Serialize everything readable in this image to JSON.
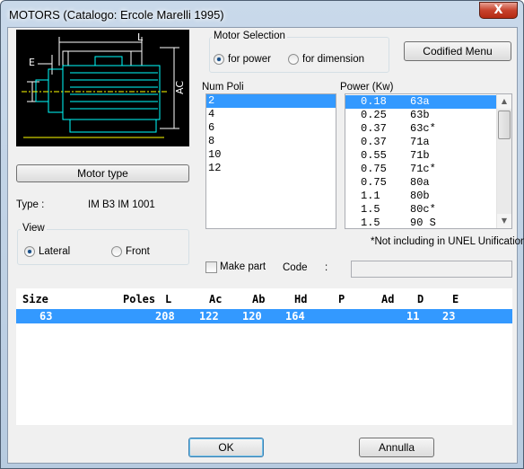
{
  "window": {
    "title": "MOTORS (Catalogo: Ercole Marelli 1995)",
    "close_label": "X"
  },
  "motor_selection": {
    "label": "Motor Selection",
    "options": [
      {
        "label": "for power",
        "selected": true
      },
      {
        "label": "for dimension",
        "selected": false
      }
    ]
  },
  "codified_menu_label": "Codified Menu",
  "drawing": {
    "dim_l": "L",
    "dim_e": "E",
    "dim_ac": "AC"
  },
  "num_poli": {
    "label": "Num Poli",
    "items": [
      "2",
      "4",
      "6",
      "8",
      "10",
      "12"
    ],
    "selected_index": 0
  },
  "power": {
    "label": "Power (Kw)",
    "items": [
      {
        "kw": "0.18",
        "code": "63a"
      },
      {
        "kw": "0.25",
        "code": "63b"
      },
      {
        "kw": "0.37",
        "code": "63c*"
      },
      {
        "kw": "0.37",
        "code": "71a"
      },
      {
        "kw": "0.55",
        "code": "71b"
      },
      {
        "kw": "0.75",
        "code": "71c*"
      },
      {
        "kw": "0.75",
        "code": "80a"
      },
      {
        "kw": "1.1",
        "code": "80b"
      },
      {
        "kw": "1.5",
        "code": "80c*"
      },
      {
        "kw": "1.5",
        "code": "90 S"
      }
    ],
    "selected_index": 0
  },
  "motor_type_label": "Motor type",
  "type": {
    "label": "Type  :",
    "value": "IM B3 IM 1001"
  },
  "view": {
    "label": "View",
    "options": [
      {
        "label": "Lateral",
        "selected": true
      },
      {
        "label": "Front",
        "selected": false
      }
    ]
  },
  "unel_note": "*Not including in UNEL Unification",
  "make_part": {
    "label": "Make part",
    "checked": false
  },
  "code": {
    "label": "Code",
    "separator": ":",
    "value": ""
  },
  "table": {
    "headers": [
      "Size",
      "Poles",
      "L",
      "Ac",
      "Ab",
      "Hd",
      "P",
      "Ad",
      "D",
      "E"
    ],
    "rows": [
      [
        "63",
        "",
        "208",
        "122",
        "120",
        "164",
        "",
        "",
        "11",
        "23"
      ]
    ]
  },
  "buttons": {
    "ok": "OK",
    "cancel": "Annulla"
  }
}
